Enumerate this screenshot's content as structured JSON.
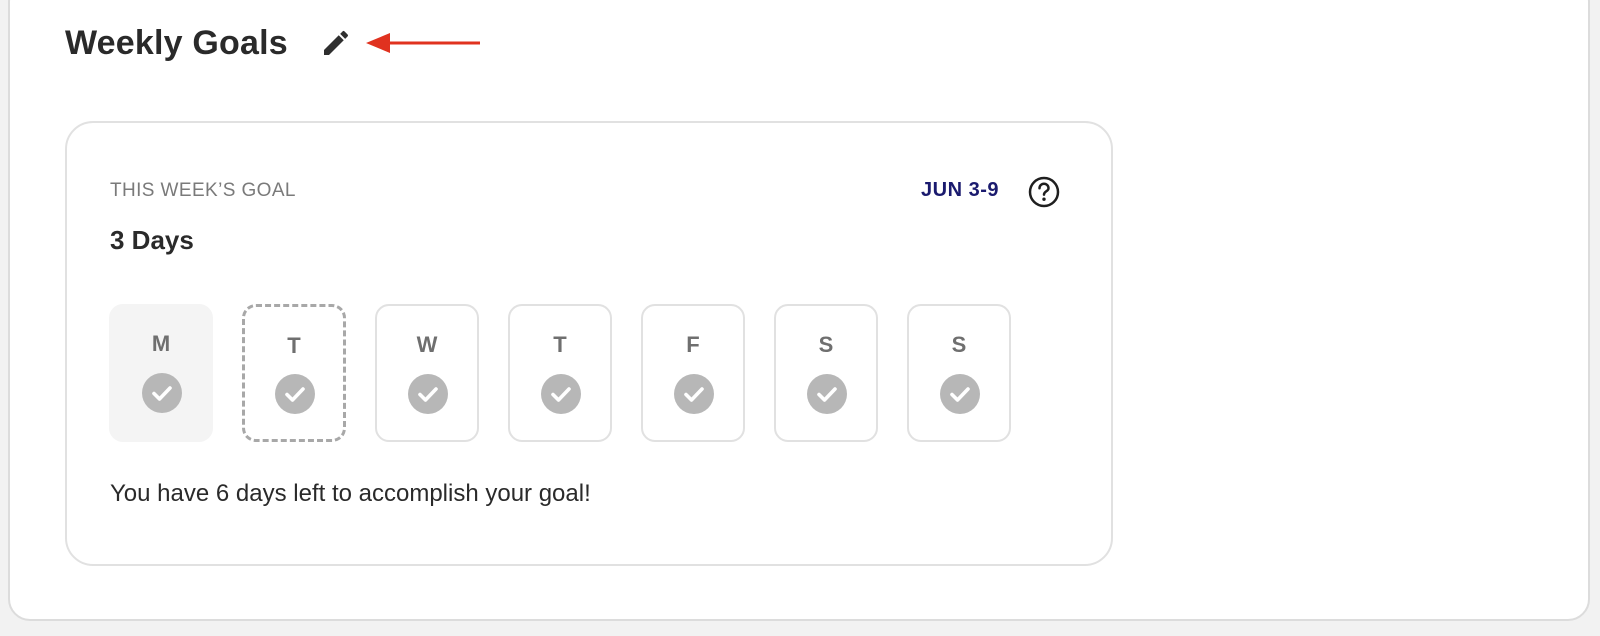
{
  "section": {
    "title": "Weekly Goals"
  },
  "goal_card": {
    "label": "THIS WEEK’S GOAL",
    "value": "3 Days",
    "date_range": "JUN 3-9",
    "days": [
      {
        "letter": "M",
        "state": "today"
      },
      {
        "letter": "T",
        "state": "selected"
      },
      {
        "letter": "W",
        "state": "default"
      },
      {
        "letter": "T",
        "state": "default"
      },
      {
        "letter": "F",
        "state": "default"
      },
      {
        "letter": "S",
        "state": "default"
      },
      {
        "letter": "S",
        "state": "default"
      }
    ],
    "progress_text": "You have 6 days left to accomplish your goal!"
  },
  "icons": {
    "edit": "pencil-icon",
    "help": "question-circle-icon",
    "check": "checkmark-circle-icon",
    "annotation": "red-arrow-pointing-left"
  },
  "colors": {
    "title": "#2a2a2a",
    "date_range": "#1a1a6e",
    "check_fill": "#b7b7b7",
    "annotation_arrow": "#e0321f",
    "card_border": "#e1e1e1"
  }
}
